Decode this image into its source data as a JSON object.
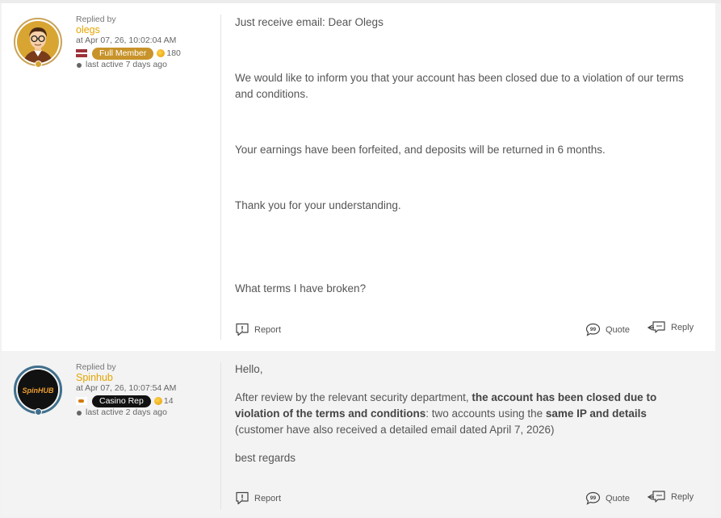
{
  "post1": {
    "replied_by": "Replied by",
    "username": "olegs",
    "date": "at Apr 07, 26, 10:02:04 AM",
    "rank": "Full Member",
    "points": "180",
    "last_active": "last active 7 days ago",
    "body": {
      "p1": "Just receive email: Dear Olegs",
      "p2": "We would like to inform you that your account has been closed due to a violation of our terms and conditions.",
      "p3": "Your earnings have been forfeited, and deposits will be returned in 6 months.",
      "p4": "Thank you for your understanding.",
      "p5": "What terms I have broken?"
    },
    "actions": {
      "report": "Report",
      "quote": "Quote",
      "reply": "Reply"
    }
  },
  "post2": {
    "replied_by": "Replied by",
    "username": "Spinhub",
    "date": "at Apr 07, 26, 10:07:54 AM",
    "rank": "Casino Rep",
    "points": "14",
    "last_active": "last active 2 days ago",
    "avatar_logo": "SpinHUB",
    "body": {
      "p1": "Hello,",
      "p2_a": "After review by the relevant security department, ",
      "p2_b": "the account has been closed due to violation of the terms and conditions",
      "p2_c": ": two accounts using the ",
      "p2_d": "same IP and details",
      "p2_e": " (customer have also received a detailed email dated April 7, 2026)",
      "p3": "best regards"
    },
    "actions": {
      "report": "Report",
      "quote": "Quote",
      "reply": "Reply"
    }
  },
  "colors": {
    "username": "#e5a500",
    "rank_full_member": "#c8932a",
    "rank_casino_rep": "#111111"
  }
}
